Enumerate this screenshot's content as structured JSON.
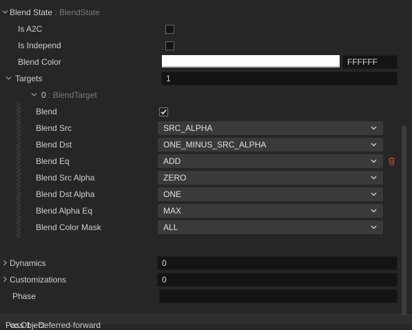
{
  "blend_state": {
    "label": "Blend State",
    "type": " : BlendState",
    "is_a2c_label": "Is A2C",
    "is_independ_label": "Is Independ",
    "blend_color_label": "Blend Color",
    "blend_color_hex": "FFFFFF",
    "blend_color_swatch": "#ffffff",
    "targets_label": "Targets",
    "targets_value": "1"
  },
  "target": {
    "label": "0",
    "type": " : BlendTarget",
    "fields": [
      {
        "label": "Blend",
        "kind": "checkbox",
        "checked": true
      },
      {
        "label": "Blend Src",
        "value": "SRC_ALPHA"
      },
      {
        "label": "Blend Dst",
        "value": "ONE_MINUS_SRC_ALPHA"
      },
      {
        "label": "Blend Eq",
        "value": "ADD"
      },
      {
        "label": "Blend Src Alpha",
        "value": "ZERO"
      },
      {
        "label": "Blend Dst Alpha",
        "value": "ONE"
      },
      {
        "label": "Blend Alpha Eq",
        "value": "MAX"
      },
      {
        "label": "Blend Color Mask",
        "value": "ALL"
      }
    ]
  },
  "dynamics": {
    "label": "Dynamics",
    "value": "0"
  },
  "customizations": {
    "label": "Customizations",
    "value": "0"
  },
  "phase": {
    "label": "Phase",
    "value": ""
  },
  "footer": {
    "label": "Pass 1 - Deferred-forward",
    "type": " : cc.Object"
  },
  "icons": {
    "delete": "trash-icon"
  },
  "colors": {
    "delete_icon": "#c8402f"
  }
}
